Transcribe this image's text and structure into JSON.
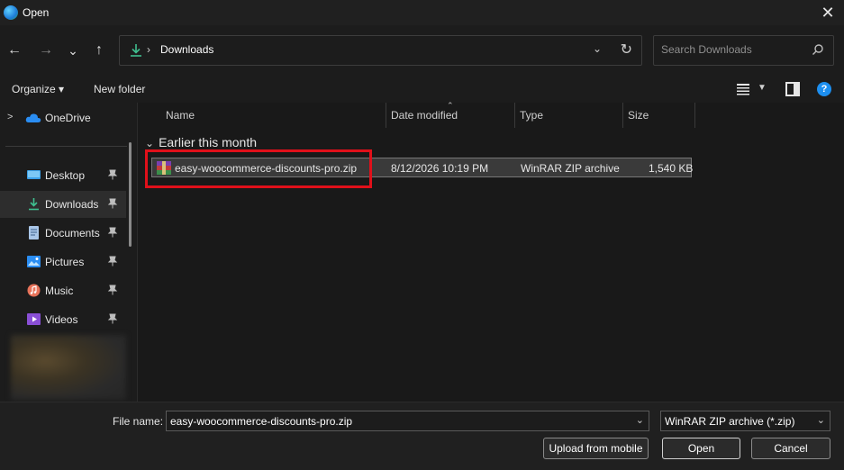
{
  "window": {
    "title": "Open",
    "close_glyph": "✕"
  },
  "nav": {
    "back_glyph": "←",
    "forward_glyph": "→",
    "recent_glyph": "⌄",
    "up_glyph": "↑",
    "breadcrumb_sep": "›",
    "location": "Downloads",
    "address_dropdown_glyph": "⌄",
    "refresh_glyph": "↻",
    "search_placeholder": "Search Downloads"
  },
  "commands": {
    "organize": "Organize ▾",
    "new_folder": "New folder",
    "view_dropdown_glyph": "▼",
    "help_glyph": "?"
  },
  "sidebar": {
    "expand_glyph": ">",
    "onedrive": "OneDrive",
    "items": [
      {
        "label": "Desktop",
        "icon": "desktop-icon",
        "active": false
      },
      {
        "label": "Downloads",
        "icon": "downloads-icon",
        "active": true
      },
      {
        "label": "Documents",
        "icon": "documents-icon",
        "active": false
      },
      {
        "label": "Pictures",
        "icon": "pictures-icon",
        "active": false
      },
      {
        "label": "Music",
        "icon": "music-icon",
        "active": false
      },
      {
        "label": "Videos",
        "icon": "videos-icon",
        "active": false
      }
    ]
  },
  "columns": {
    "name": "Name",
    "date": "Date modified",
    "type": "Type",
    "size": "Size",
    "sort_caret": "⌃"
  },
  "group": {
    "chevron": "⌄",
    "label": "Earlier this month"
  },
  "files": [
    {
      "name": "easy-woocommerce-discounts-pro.zip",
      "date": "8/12/2026 10:19 PM",
      "type": "WinRAR ZIP archive",
      "size": "1,540 KB",
      "icon": "winrar-zip-icon"
    }
  ],
  "footer": {
    "file_name_label": "File name:",
    "file_name_value": "easy-woocommerce-discounts-pro.zip",
    "dropdown_glyph": "⌄",
    "filter_value": "WinRAR ZIP archive (*.zip)",
    "upload_mobile": "Upload from mobile",
    "open": "Open",
    "cancel": "Cancel"
  },
  "colors": {
    "highlight": "#e0101a",
    "accent": "#1d8ff0"
  }
}
